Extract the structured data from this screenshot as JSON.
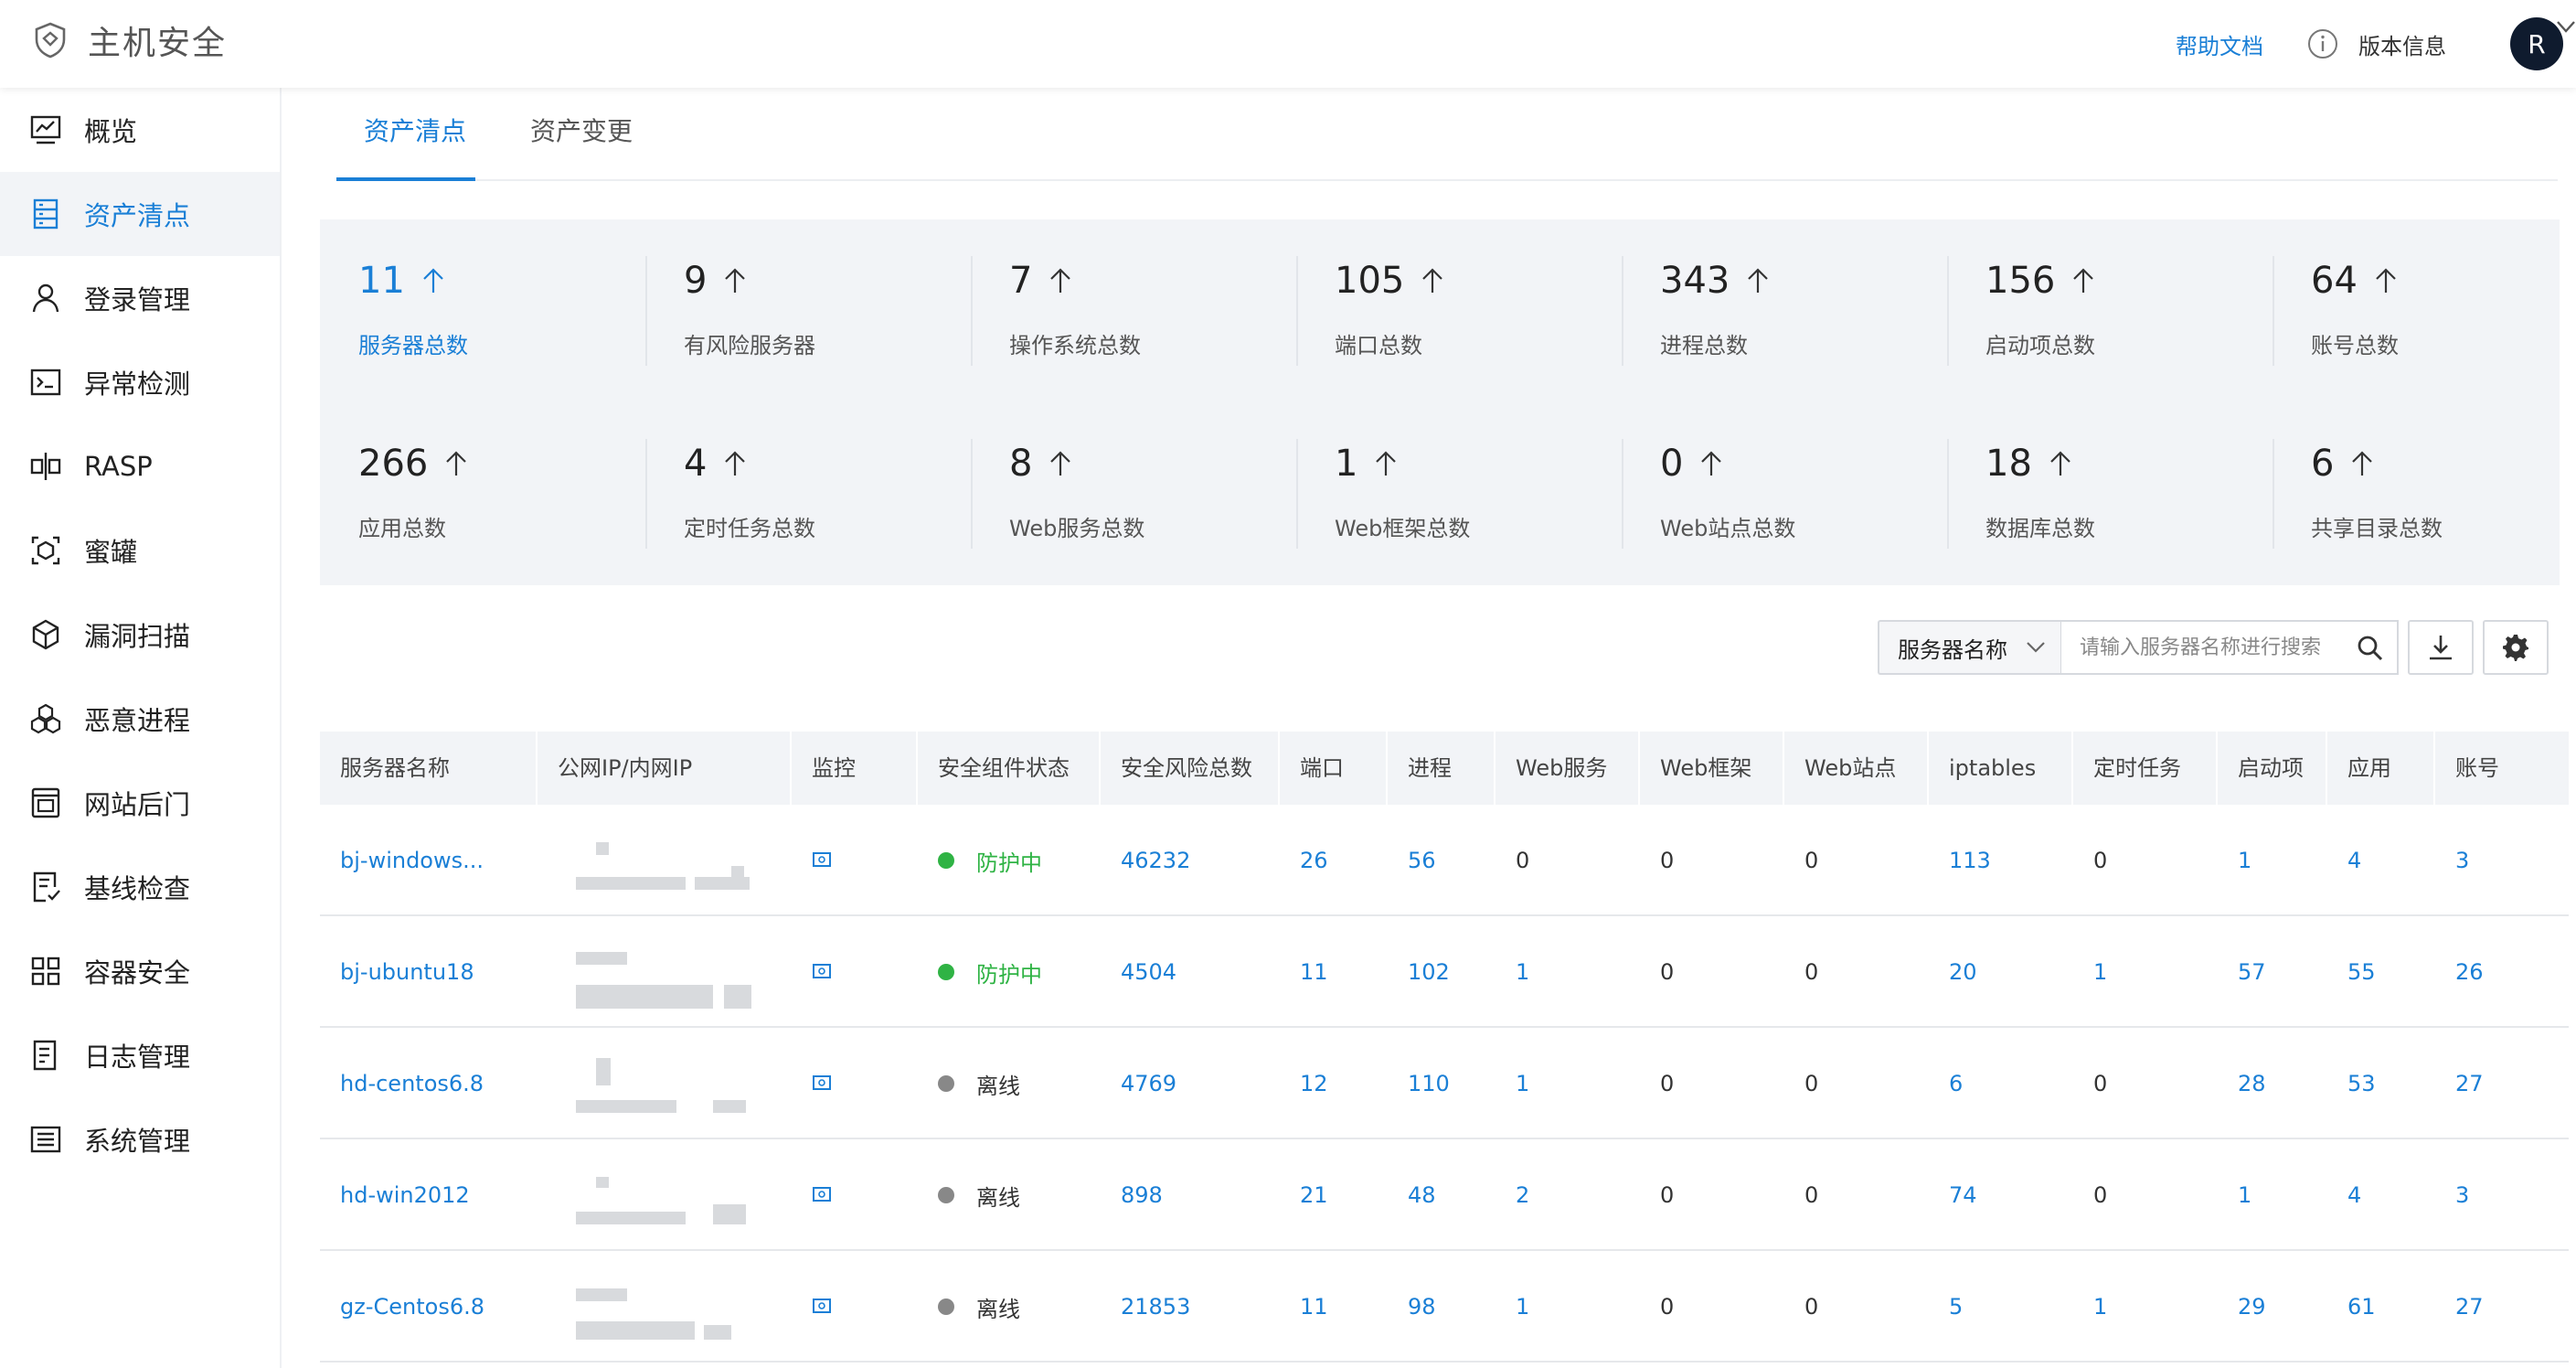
{
  "header": {
    "title": "主机安全",
    "help_label": "帮助文档",
    "version_label": "版本信息",
    "avatar_letter": "R",
    "accent_color": "#1a7fd6"
  },
  "sidebar": {
    "items": [
      {
        "label": "概览",
        "icon": "monitor-chart-icon"
      },
      {
        "label": "资产清点",
        "icon": "asset-list-icon",
        "active": true
      },
      {
        "label": "登录管理",
        "icon": "user-icon"
      },
      {
        "label": "异常检测",
        "icon": "terminal-icon"
      },
      {
        "label": "RASP",
        "icon": "rasp-icon"
      },
      {
        "label": "蜜罐",
        "icon": "honeypot-icon"
      },
      {
        "label": "漏洞扫描",
        "icon": "vuln-scan-icon"
      },
      {
        "label": "恶意进程",
        "icon": "malware-process-icon"
      },
      {
        "label": "网站后门",
        "icon": "webshell-icon"
      },
      {
        "label": "基线检查",
        "icon": "baseline-check-icon"
      },
      {
        "label": "容器安全",
        "icon": "container-grid-icon"
      },
      {
        "label": "日志管理",
        "icon": "log-icon"
      },
      {
        "label": "系统管理",
        "icon": "system-settings-icon"
      }
    ]
  },
  "tabs": [
    {
      "label": "资产清点",
      "active": true
    },
    {
      "label": "资产变更",
      "active": false
    }
  ],
  "stats": {
    "row1": [
      {
        "value": "11",
        "label": "服务器总数"
      },
      {
        "value": "9",
        "label": "有风险服务器"
      },
      {
        "value": "7",
        "label": "操作系统总数"
      },
      {
        "value": "105",
        "label": "端口总数"
      },
      {
        "value": "343",
        "label": "进程总数"
      },
      {
        "value": "156",
        "label": "启动项总数"
      },
      {
        "value": "64",
        "label": "账号总数"
      }
    ],
    "row2": [
      {
        "value": "266",
        "label": "应用总数"
      },
      {
        "value": "4",
        "label": "定时任务总数"
      },
      {
        "value": "8",
        "label": "Web服务总数"
      },
      {
        "value": "1",
        "label": "Web框架总数"
      },
      {
        "value": "0",
        "label": "Web站点总数"
      },
      {
        "value": "18",
        "label": "数据库总数"
      },
      {
        "value": "6",
        "label": "共享目录总数"
      }
    ]
  },
  "search": {
    "field_select": "服务器名称",
    "placeholder": "请输入服务器名称进行搜索"
  },
  "table": {
    "columns": [
      "服务器名称",
      "公网IP/内网IP",
      "监控",
      "安全组件状态",
      "安全风险总数",
      "端口",
      "进程",
      "Web服务",
      "Web框架",
      "Web站点",
      "iptables",
      "定时任务",
      "启动项",
      "应用",
      "账号"
    ],
    "rows": [
      {
        "name": "bj-windows...",
        "status": "防护中",
        "online": true,
        "risk": "46232",
        "port": "26",
        "proc": "56",
        "websvc": "0",
        "webfw": "0",
        "website": "0",
        "iptables": "113",
        "cron": "0",
        "startup": "1",
        "app": "4",
        "account": "3"
      },
      {
        "name": "bj-ubuntu18",
        "status": "防护中",
        "online": true,
        "risk": "4504",
        "port": "11",
        "proc": "102",
        "websvc": "1",
        "webfw": "0",
        "website": "0",
        "iptables": "20",
        "cron": "1",
        "startup": "57",
        "app": "55",
        "account": "26"
      },
      {
        "name": "hd-centos6.8",
        "status": "离线",
        "online": false,
        "risk": "4769",
        "port": "12",
        "proc": "110",
        "websvc": "1",
        "webfw": "0",
        "website": "0",
        "iptables": "6",
        "cron": "0",
        "startup": "28",
        "app": "53",
        "account": "27"
      },
      {
        "name": "hd-win2012",
        "status": "离线",
        "online": false,
        "risk": "898",
        "port": "21",
        "proc": "48",
        "websvc": "2",
        "webfw": "0",
        "website": "0",
        "iptables": "74",
        "cron": "0",
        "startup": "1",
        "app": "4",
        "account": "3"
      },
      {
        "name": "gz-Centos6.8",
        "status": "离线",
        "online": false,
        "risk": "21853",
        "port": "11",
        "proc": "98",
        "websvc": "1",
        "webfw": "0",
        "website": "0",
        "iptables": "5",
        "cron": "1",
        "startup": "29",
        "app": "61",
        "account": "27"
      }
    ]
  }
}
